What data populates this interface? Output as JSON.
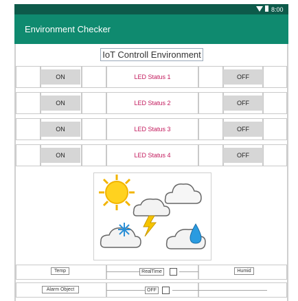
{
  "statusbar": {
    "time": "8:00"
  },
  "app": {
    "title": "Environment Checker"
  },
  "main": {
    "title": "IoT Controll Environment",
    "rows": [
      {
        "on_label": "ON",
        "status": "LED Status 1",
        "off_label": "OFF"
      },
      {
        "on_label": "ON",
        "status": "LED Status 2",
        "off_label": "OFF"
      },
      {
        "on_label": "ON",
        "status": "LED Status 3",
        "off_label": "OFF"
      },
      {
        "on_label": "ON",
        "status": "LED Status 4",
        "off_label": "OFF"
      }
    ],
    "sensor": {
      "temp_label": "Temp",
      "realtime_label": "RealTime",
      "humid_label": "Humid"
    },
    "alarm": {
      "label": "Alarm Object",
      "off_label": "OFF"
    }
  },
  "colors": {
    "appbar": "#0f8a6f",
    "statusbar": "#0d5a4a",
    "status_text": "#c2185b",
    "button": "#d6d6d6"
  },
  "icons": [
    "wifi-icon",
    "battery-icon",
    "weather-illustration"
  ]
}
